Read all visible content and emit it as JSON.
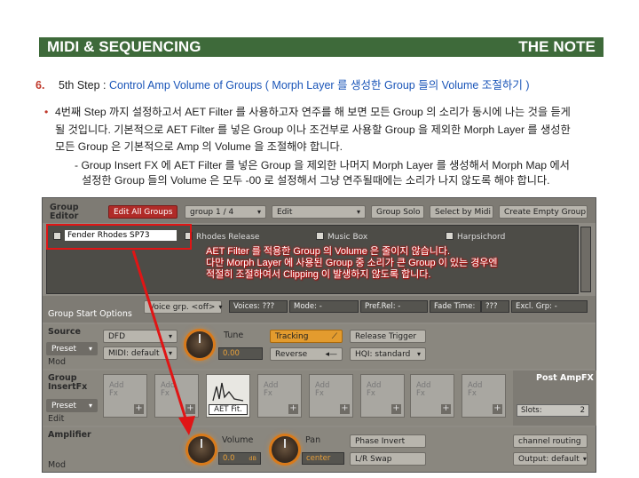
{
  "header": {
    "left": "MIDI & SEQUENCING",
    "right": "THE NOTE"
  },
  "step": {
    "num": "6.",
    "title": "5th Step : ",
    "link": "Control Amp Volume of Groups ( Morph Layer 를 생성한 Group 들의 Volume 조절하기 )"
  },
  "bullet": {
    "line1": "4번째 Step 까지 설정하고서 AET Filter 를 사용하고자 연주를 해 보면 모든 Group 의 소리가 동시에 나는 것을 듣게",
    "line2": "될 것입니다. 기본적으로 AET Filter 를 넣은 Group 이나 조건부로 사용할 Group 을 제외한 Morph Layer 를 생성한",
    "line3": "모든 Group 은 기본적으로 Amp 의 Volume 을 조절해야 합니다."
  },
  "sub": {
    "line1": "- Group Insert FX 에 AET Filter 를 넣은 Group 을 제외한 나머지 Morph Layer 를 생성해서 Morph Map 에서",
    "line2": "설정한 Group 들의 Volume 은 모두 -00 로 설정해서 그냥 연주될때에는 소리가 나지 않도록 해야 합니다."
  },
  "panel": {
    "group_editor": "Group\nEditor",
    "edit_all_groups": "Edit All Groups",
    "group_select": "group 1 / 4",
    "edit_menu": "Edit",
    "group_solo": "Group Solo",
    "select_by_midi": "Select by Midi",
    "create_empty_group": "Create Empty Group",
    "groups": [
      "Fender Rhodes SP73",
      "Rhodes Release",
      "Music Box",
      "Harpsichord"
    ],
    "annotation": {
      "line1": "AET Filter 를 적용한 Group 의 Volume 은 줄이지 않습니다.",
      "line2": "다만 Morph Layer 에 사용된 Group 중 소리가 큰 Group 이 있는 경우엔",
      "line3": "적절히 조절하여서 Clipping 이 발생하지 않도록 합니다."
    },
    "group_start_options": "Group Start Options",
    "voice_grp": "Voice grp. <off>",
    "voices": "Voices: ???",
    "mode": "Mode: -",
    "pref_rel": "Pref.Rel: -",
    "fade_time": "Fade Time:",
    "fade_val": "???",
    "excl_grp": "Excl. Grp: -",
    "source": "Source",
    "preset": "Preset",
    "mod": "Mod",
    "dfd": "DFD",
    "midi_default": "MIDI: default",
    "tune": "Tune",
    "tune_val": "0.00",
    "tracking": "Tracking",
    "release_trigger": "Release Trigger",
    "reverse": "Reverse",
    "hq_standard": "HQI: standard",
    "group_insert_fx": "Group\nInsertFx",
    "edit": "Edit",
    "add_fx": "Add\nFx",
    "aet_fit": "AET Fit.",
    "post_amp_fx": "Post AmpFX",
    "slots": "Slots:",
    "slots_val": "2",
    "amplifier": "Amplifier",
    "volume": "Volume",
    "volume_val": "0.0",
    "volume_unit": "dB",
    "pan": "Pan",
    "pan_val": "center",
    "phase_invert": "Phase Invert",
    "lr_swap": "L/R Swap",
    "channel_routing": "channel routing",
    "output_default": "Output: default"
  }
}
